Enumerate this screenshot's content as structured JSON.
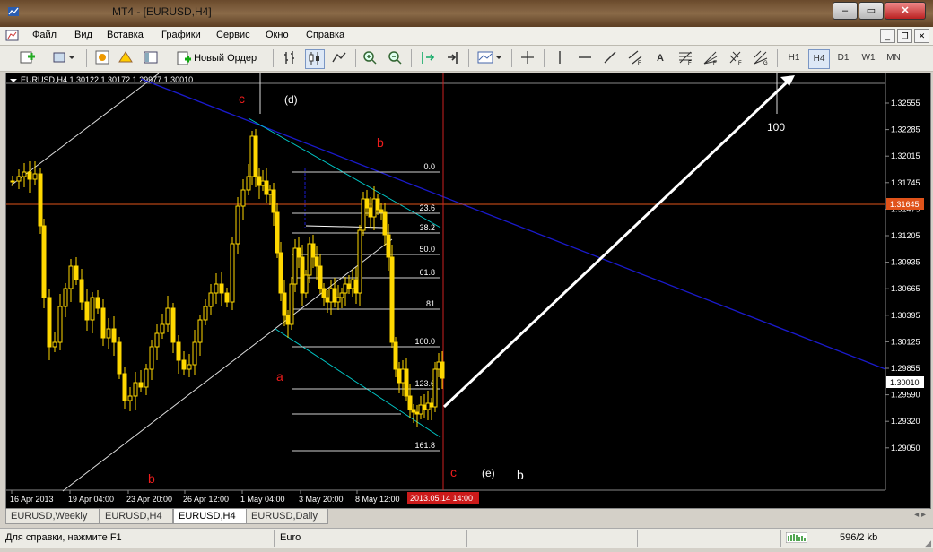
{
  "window": {
    "title": "MT4 - [EURUSD,H4]"
  },
  "menu": [
    "Файл",
    "Вид",
    "Вставка",
    "Графики",
    "Сервис",
    "Окно",
    "Справка"
  ],
  "toolbar": {
    "new_order": "Новый Ордер",
    "text_tool": "A",
    "timeframes": [
      "H1",
      "H4",
      "D1",
      "W1",
      "MN"
    ],
    "active_timeframe": "H4"
  },
  "chart": {
    "info": "EURUSD,H4  1.30122 1.30172 1.29977 1.30010",
    "price_axis": [
      "1.32555",
      "1.32285",
      "1.32015",
      "1.31745",
      "1.31475",
      "1.31205",
      "1.30935",
      "1.30665",
      "1.30395",
      "1.30125",
      "1.29855",
      "1.29590",
      "1.29320",
      "1.29050"
    ],
    "current_price": "1.30010",
    "hline_price": "1.31645",
    "time_axis": [
      "16 Apr 2013",
      "19 Apr 04:00",
      "23 Apr 20:00",
      "26 Apr 12:00",
      "1 May 04:00",
      "3 May 20:00",
      "8 May 12:00"
    ],
    "cursor_time": "2013.05.14 14:00",
    "fib_levels": [
      "0.0",
      "23.6",
      "38.2",
      "50.0",
      "61.8",
      "81",
      "100.0",
      "123.6",
      "161.8"
    ],
    "annotations": {
      "c_top": "c",
      "d": "(d)",
      "b_mid": "b",
      "a": "a",
      "b_low": "b",
      "c_bottom": "c",
      "e": "(e)",
      "b_right": "b",
      "target": "100"
    },
    "colors": {
      "candle": "#ffd800",
      "trend_blue": "#1a1acc",
      "channel_cyan": "#00c8c8",
      "hline": "#e0531a",
      "vline": "#cc2020",
      "label_red": "#ee1c1c",
      "arrow": "#ffffff"
    }
  },
  "tabs": [
    "EURUSD,Weekly",
    "EURUSD,H4",
    "EURUSD,H4",
    "EURUSD,Daily"
  ],
  "active_tab": 2,
  "status": {
    "help": "Для справки, нажмите F1",
    "profile": "Euro",
    "traffic": "596/2 kb"
  }
}
